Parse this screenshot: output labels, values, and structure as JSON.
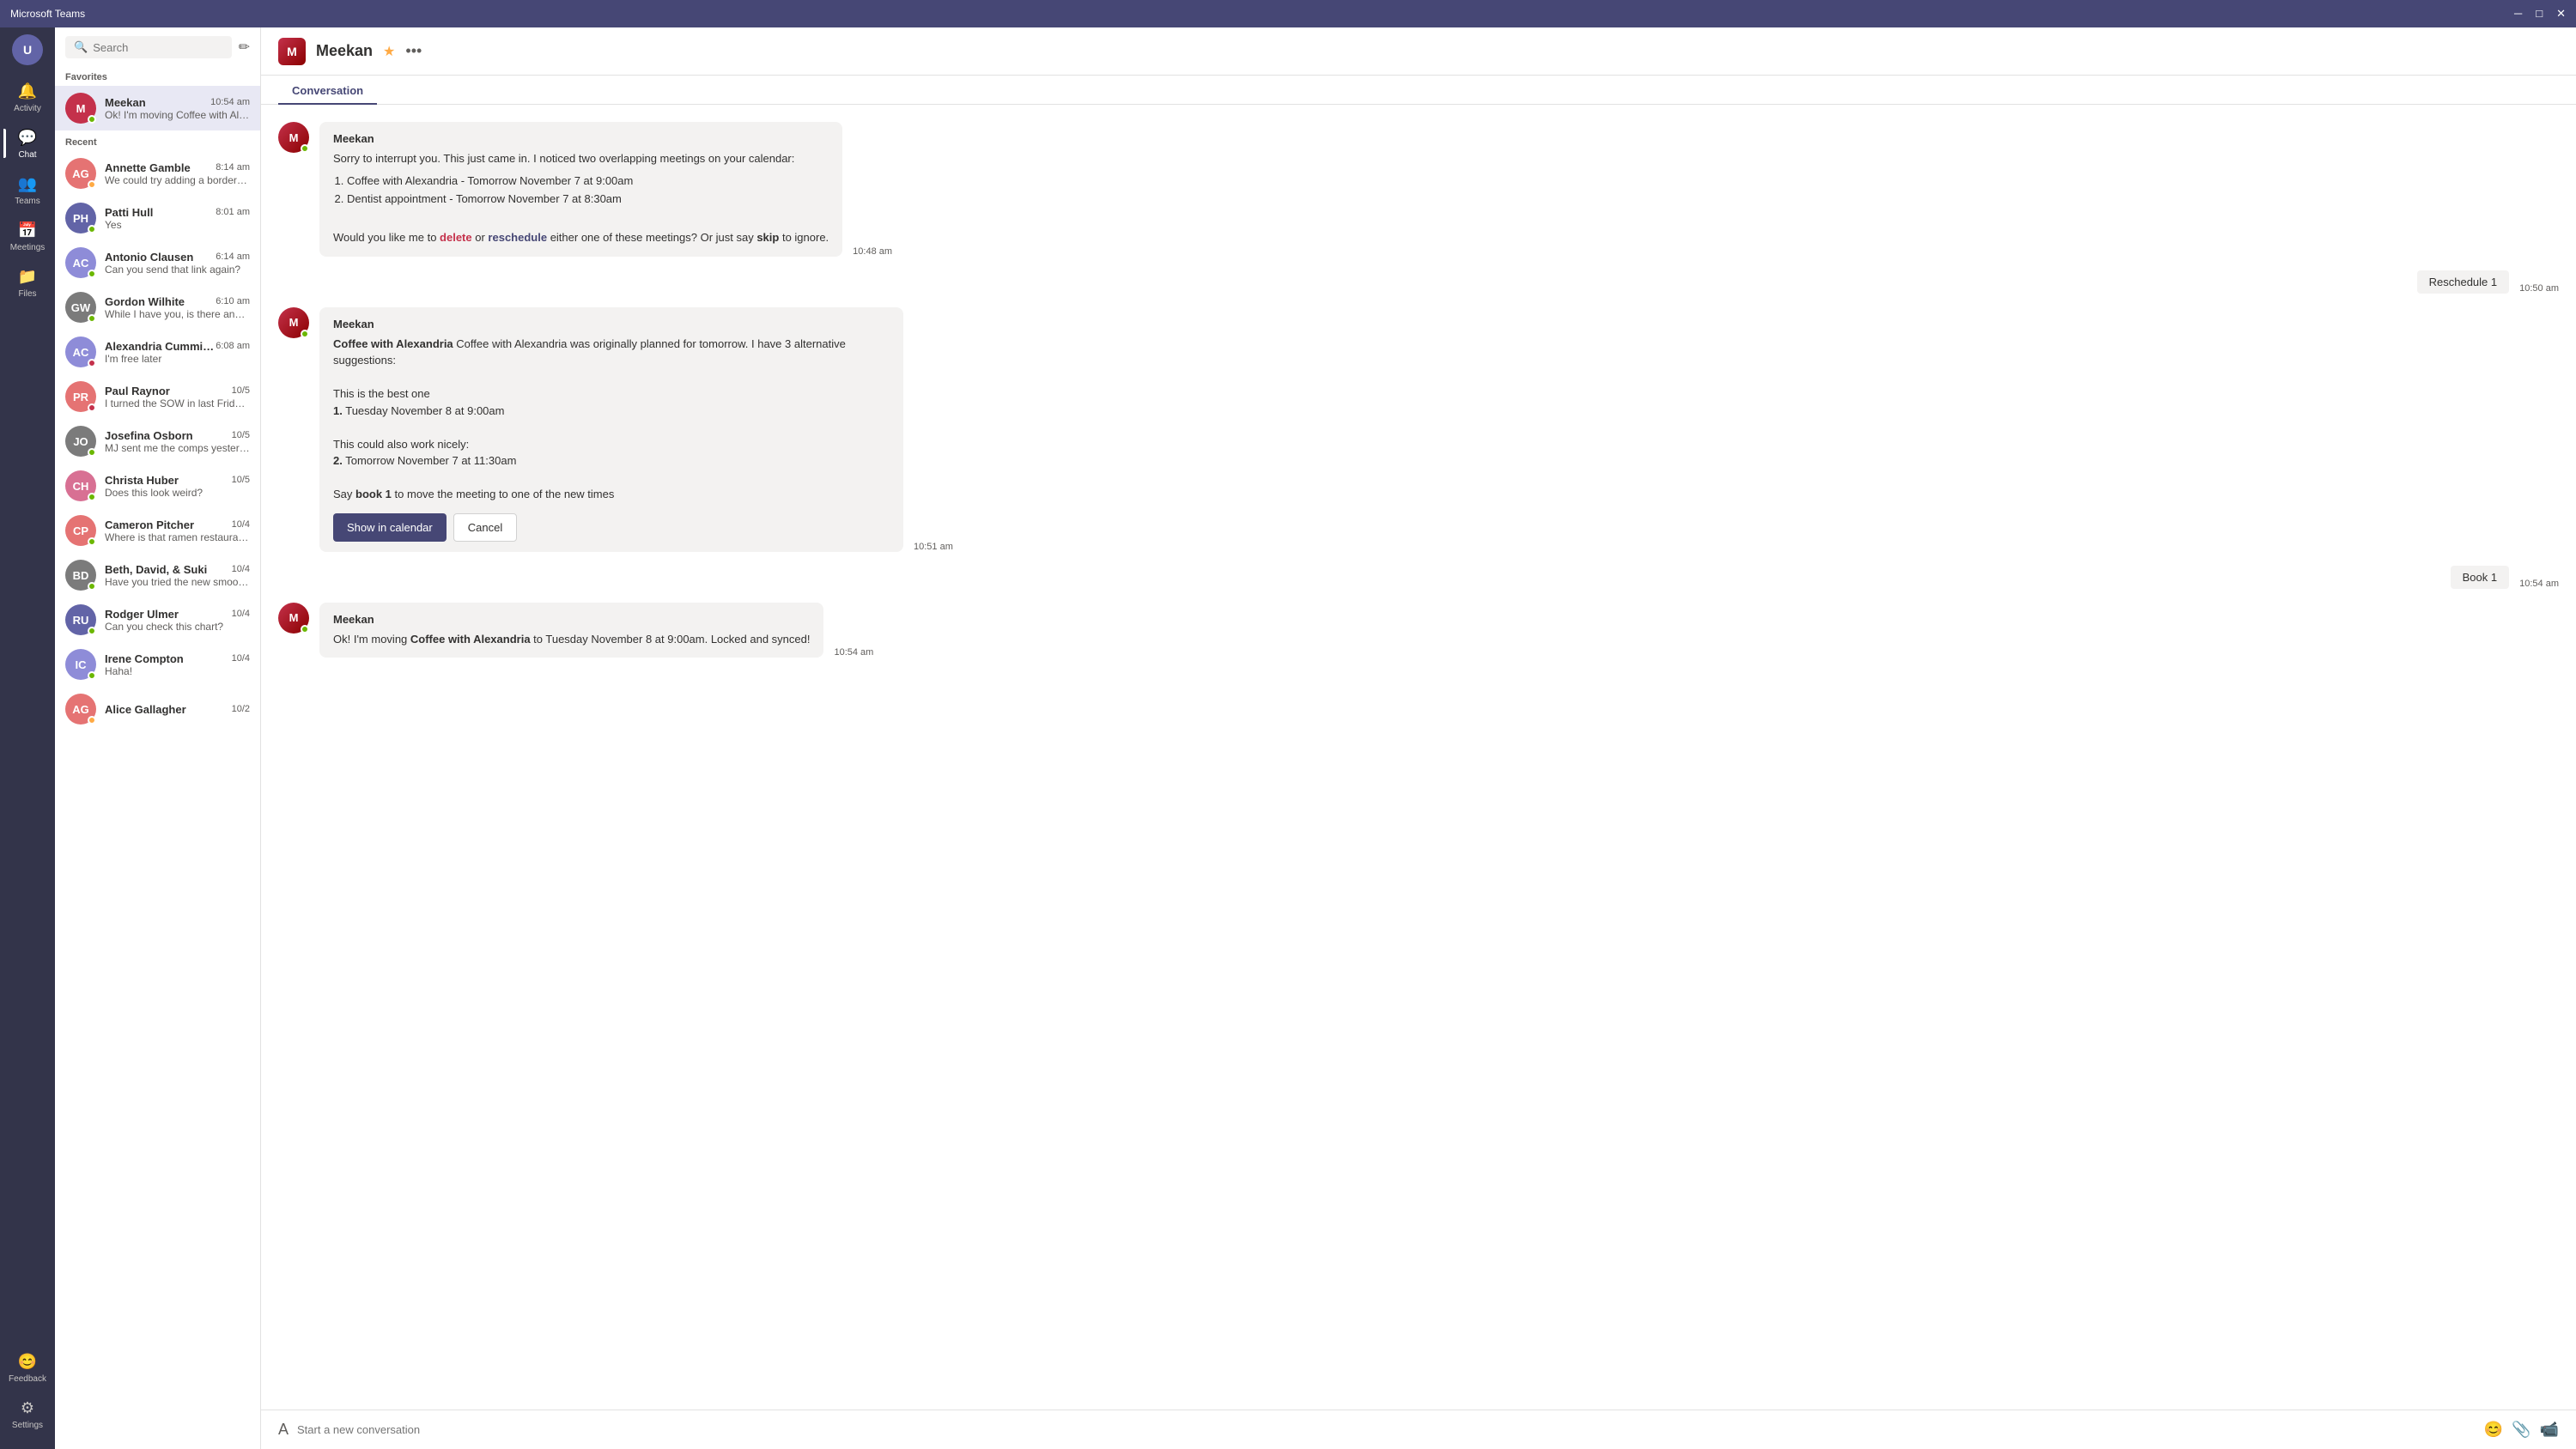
{
  "titlebar": {
    "title": "Microsoft Teams",
    "minimize": "─",
    "maximize": "□",
    "close": "✕"
  },
  "sidebar": {
    "user_initials": "U",
    "nav_items": [
      {
        "id": "activity",
        "label": "Activity",
        "icon": "🔔",
        "active": false,
        "badge": ""
      },
      {
        "id": "chat",
        "label": "Chat",
        "icon": "💬",
        "active": true,
        "badge": ""
      },
      {
        "id": "teams",
        "label": "Teams",
        "icon": "👥",
        "active": false,
        "badge": ""
      },
      {
        "id": "meetings",
        "label": "Meetings",
        "icon": "📅",
        "active": false,
        "badge": ""
      },
      {
        "id": "files",
        "label": "Files",
        "icon": "📁",
        "active": false,
        "badge": ""
      }
    ],
    "bottom_items": [
      {
        "id": "feedback",
        "label": "Feedback",
        "icon": "😊"
      },
      {
        "id": "settings",
        "label": "Settings",
        "icon": "⚙"
      }
    ]
  },
  "chat_list": {
    "search_placeholder": "Search",
    "favorites_label": "Favorites",
    "recent_label": "Recent",
    "favorites": [
      {
        "name": "Meekan",
        "time": "10:54 am",
        "preview": "Ok! I'm moving Coffee with Alexan...",
        "initials": "M",
        "color": "#c4314b",
        "status": "online",
        "active": true
      }
    ],
    "recent": [
      {
        "name": "Annette Gamble",
        "time": "8:14 am",
        "preview": "We could try adding a border u...",
        "initials": "AG",
        "color": "#e57373",
        "status": "away"
      },
      {
        "name": "Patti Hull",
        "time": "8:01 am",
        "preview": "Yes",
        "initials": "PH",
        "color": "#6264a7",
        "status": "online"
      },
      {
        "name": "Antonio Clausen",
        "time": "6:14 am",
        "preview": "Can you send that link again?",
        "initials": "AC",
        "color": "#8e8cd8",
        "status": "online"
      },
      {
        "name": "Gordon Wilhite",
        "time": "6:10 am",
        "preview": "While I have you, is there anyth...",
        "initials": "GW",
        "color": "#7b7b7b",
        "status": "online"
      },
      {
        "name": "Alexandria Cummings",
        "time": "6:08 am",
        "preview": "I'm free later",
        "initials": "AC2",
        "color": "#8e8cd8",
        "status": "busy"
      },
      {
        "name": "Paul Raynor",
        "time": "10/5",
        "preview": "I turned the SOW in last Friday t...",
        "initials": "PR",
        "color": "#e57373",
        "status": "busy"
      },
      {
        "name": "Josefina Osborn",
        "time": "10/5",
        "preview": "MJ sent me the comps yesterday",
        "initials": "JO",
        "color": "#7b7b7b",
        "status": "online"
      },
      {
        "name": "Christa Huber",
        "time": "10/5",
        "preview": "Does this look weird?",
        "initials": "CH",
        "color": "#d87093",
        "status": "online"
      },
      {
        "name": "Cameron Pitcher",
        "time": "10/4",
        "preview": "Where is that ramen restaurant yo...",
        "initials": "CP",
        "color": "#e57373",
        "status": "online"
      },
      {
        "name": "Beth, David, & Suki",
        "time": "10/4",
        "preview": "Have you tried the new smoothie..",
        "initials": "BD",
        "color": "#7b7b7b",
        "status": "online"
      },
      {
        "name": "Rodger Ulmer",
        "time": "10/4",
        "preview": "Can you check this chart?",
        "initials": "RU",
        "color": "#6264a7",
        "status": "online"
      },
      {
        "name": "Irene Compton",
        "time": "10/4",
        "preview": "Haha!",
        "initials": "IC",
        "color": "#8e8cd8",
        "status": "online"
      },
      {
        "name": "Alice Gallagher",
        "time": "10/2",
        "preview": "",
        "initials": "AG2",
        "color": "#e57373",
        "status": "away"
      }
    ]
  },
  "topbar": {
    "bot_letter": "M",
    "title": "Meekan",
    "tab": "Conversation"
  },
  "messages": [
    {
      "id": "msg1",
      "sender": "Meekan",
      "time": "10:48 am",
      "type": "bot",
      "content": "Sorry to interrupt you. This just came in. I noticed two overlapping meetings on your calendar:",
      "list": [
        "Coffee with Alexandria - Tomorrow November 7 at 9:00am",
        "Dentist appointment - Tomorrow November 7 at 8:30am"
      ],
      "suffix": "Would you like me to delete or reschedule either one of these meetings? Or just say skip to ignore."
    },
    {
      "id": "msg2",
      "type": "user_action",
      "label": "Reschedule 1",
      "time": "10:50 am"
    },
    {
      "id": "msg3",
      "sender": "Meekan",
      "time": "10:51 am",
      "type": "bot_with_buttons",
      "intro": "Coffee with Alexandria was originally planned for tomorrow. I have 3 alternative suggestions:",
      "best_label": "This is the best one",
      "option1_num": "1.",
      "option1": "Tuesday November 8 at 9:00am",
      "nicely_label": "This could also work nicely:",
      "option2_num": "2.",
      "option2": "Tomorrow November 7 at 11:30am",
      "cta": "Say book 1 to move the meeting to one of the new times",
      "btn_primary": "Show in calendar",
      "btn_secondary": "Cancel"
    },
    {
      "id": "msg4",
      "type": "user_action",
      "label": "Book 1",
      "time": "10:54 am"
    },
    {
      "id": "msg5",
      "sender": "Meekan",
      "time": "10:54 am",
      "type": "bot_simple",
      "prefix": "Ok! I'm moving ",
      "bold": "Coffee with Alexandria",
      "suffix": " to Tuesday November 8 at 9:00am. Locked and synced!"
    }
  ],
  "compose": {
    "placeholder": "Start a new conversation"
  }
}
